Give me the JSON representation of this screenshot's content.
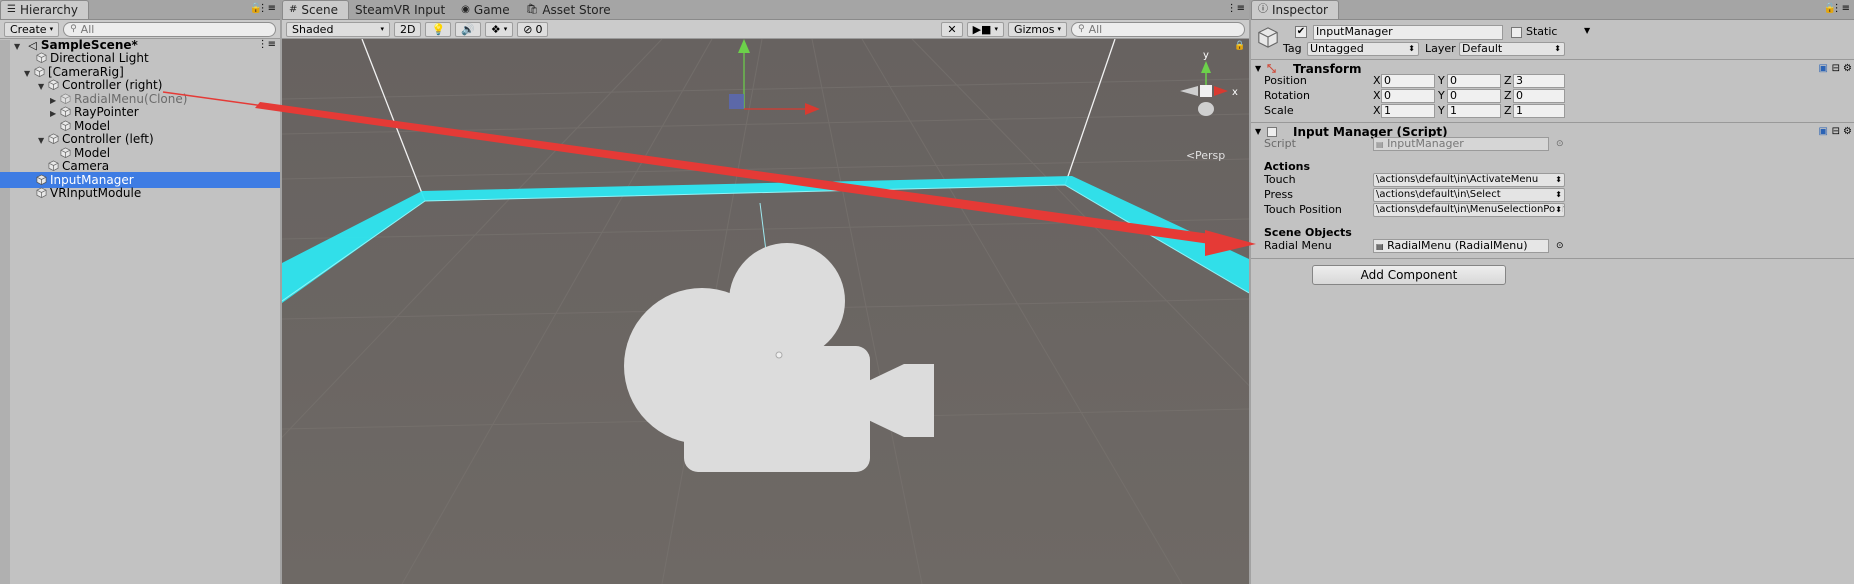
{
  "hierarchy": {
    "tab_label": "Hierarchy",
    "create_label": "Create",
    "search_placeholder": "All",
    "scene_name": "SampleScene*",
    "items": [
      {
        "label": "Directional Light"
      },
      {
        "label": "[CameraRig]"
      },
      {
        "label": "Controller (right)"
      },
      {
        "label": "RadialMenu(Clone)"
      },
      {
        "label": "RayPointer"
      },
      {
        "label": "Model"
      },
      {
        "label": "Controller (left)"
      },
      {
        "label": "Model"
      },
      {
        "label": "Camera"
      },
      {
        "label": "InputManager"
      },
      {
        "label": "VRInputModule"
      }
    ]
  },
  "scene": {
    "tabs": [
      "Scene",
      "SteamVR Input",
      "Game",
      "Asset Store"
    ],
    "shading_mode": "Shaded",
    "mode_2d": "2D",
    "fx_count": "0",
    "gizmos_label": "Gizmos",
    "search_placeholder": "All",
    "persp_label": "Persp",
    "axis_x": "x",
    "axis_y": "y"
  },
  "inspector": {
    "tab_label": "Inspector",
    "object_name": "InputManager",
    "static_label": "Static",
    "tag_label": "Tag",
    "tag_value": "Untagged",
    "layer_label": "Layer",
    "layer_value": "Default",
    "transform": {
      "title": "Transform",
      "position_label": "Position",
      "rotation_label": "Rotation",
      "scale_label": "Scale",
      "axis_x": "X",
      "axis_y": "Y",
      "axis_z": "Z",
      "position": {
        "x": "0",
        "y": "0",
        "z": "3"
      },
      "rotation": {
        "x": "0",
        "y": "0",
        "z": "0"
      },
      "scale": {
        "x": "1",
        "y": "1",
        "z": "1"
      }
    },
    "script_component": {
      "title": "Input Manager (Script)",
      "script_label": "Script",
      "script_value": "InputManager",
      "actions_header": "Actions",
      "touch_label": "Touch",
      "touch_value": "\\actions\\default\\in\\ActivateMenu",
      "press_label": "Press",
      "press_value": "\\actions\\default\\in\\Select",
      "touch_position_label": "Touch Position",
      "touch_position_value": "\\actions\\default\\in\\MenuSelectionPosition",
      "scene_objects_header": "Scene Objects",
      "radial_menu_label": "Radial Menu",
      "radial_menu_value": "RadialMenu (RadialMenu)"
    },
    "add_component_label": "Add Component"
  },
  "colors": {
    "selection": "#3e7ce3",
    "scene_bg": "#6b6661",
    "highlight_cyan": "#2ee6f0",
    "annotation_arrow": "#e53a36"
  }
}
